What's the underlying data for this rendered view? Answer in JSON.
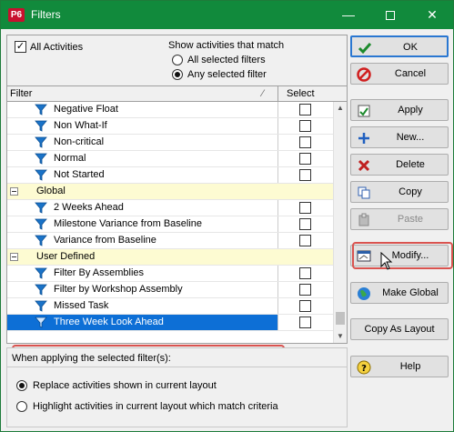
{
  "window": {
    "app_icon": "P6",
    "title": "Filters",
    "minimize": "—",
    "close": "✕"
  },
  "options": {
    "all_activities_label": "All Activities",
    "all_activities_checked": true,
    "show_match_label": "Show activities that match",
    "all_selected_label": "All selected filters",
    "any_selected_label": "Any selected filter",
    "any_selected": true
  },
  "grid": {
    "col_filter": "Filter",
    "col_select": "Select",
    "rows": [
      {
        "type": "item",
        "name": "Negative Float"
      },
      {
        "type": "item",
        "name": "Non What-If"
      },
      {
        "type": "item",
        "name": "Non-critical"
      },
      {
        "type": "item",
        "name": "Normal"
      },
      {
        "type": "item",
        "name": "Not Started"
      },
      {
        "type": "group",
        "name": "Global"
      },
      {
        "type": "item",
        "name": "2 Weeks Ahead"
      },
      {
        "type": "item",
        "name": "Milestone Variance from Baseline"
      },
      {
        "type": "item",
        "name": "Variance from Baseline"
      },
      {
        "type": "group",
        "name": "User Defined"
      },
      {
        "type": "item",
        "name": "Filter By Assemblies"
      },
      {
        "type": "item",
        "name": "Filter by Workshop Assembly"
      },
      {
        "type": "item",
        "name": "Missed Task"
      },
      {
        "type": "item",
        "name": "Three Week Look Ahead",
        "selected": true
      }
    ]
  },
  "apply_options": {
    "title": "When applying the selected filter(s):",
    "replace_label": "Replace activities shown in current layout",
    "highlight_label": "Highlight activities in current layout which match criteria",
    "replace_selected": true
  },
  "buttons": {
    "ok": "OK",
    "cancel": "Cancel",
    "apply": "Apply",
    "new": "New...",
    "delete": "Delete",
    "copy": "Copy",
    "paste": "Paste",
    "modify": "Modify...",
    "make_global": "Make Global",
    "copy_as_layout": "Copy As Layout",
    "help": "Help"
  },
  "colors": {
    "titlebar": "#118a3c",
    "selection": "#0d6fd6",
    "group_row": "#fdfbd2",
    "highlight": "#d9534f"
  }
}
